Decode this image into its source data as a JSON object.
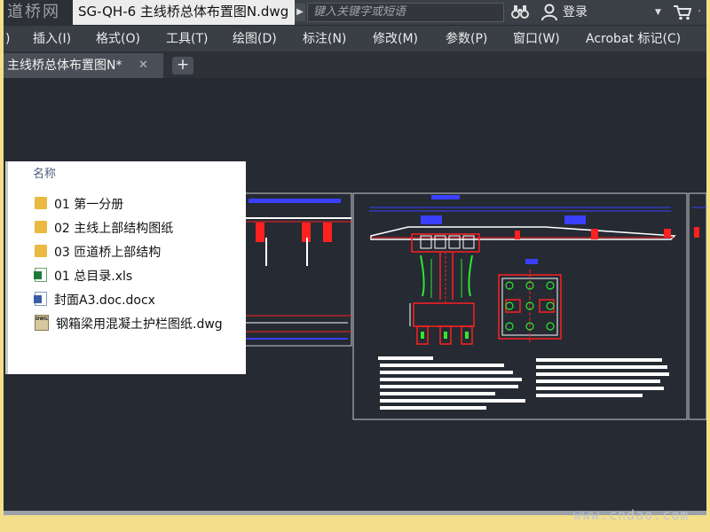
{
  "app": {
    "logo_text": "道桥网",
    "title": "SG-QH-6 主线桥总体布置图N.dwg",
    "search_placeholder": "键入关键字或短语",
    "login_label": "登录"
  },
  "menu": [
    {
      "label": ")"
    },
    {
      "label": "插入(I)"
    },
    {
      "label": "格式(O)"
    },
    {
      "label": "工具(T)"
    },
    {
      "label": "绘图(D)"
    },
    {
      "label": "标注(N)"
    },
    {
      "label": "修改(M)"
    },
    {
      "label": "参数(P)"
    },
    {
      "label": "窗口(W)"
    },
    {
      "label": "Acrobat 标记(C)"
    }
  ],
  "tabs": [
    {
      "label": "主线桥总体布置图N*"
    }
  ],
  "file_panel": {
    "column_header": "名称",
    "items": [
      {
        "name": "01 第一分册",
        "icon": "folder-icon"
      },
      {
        "name": "02 主线上部结构图纸",
        "icon": "folder-icon"
      },
      {
        "name": "03 匝道桥上部结构",
        "icon": "folder-icon"
      },
      {
        "name": "01 总目录.xls",
        "icon": "xls-icon"
      },
      {
        "name": "封面A3.doc.docx",
        "icon": "doc-icon"
      },
      {
        "name": "钢箱梁用混凝土护栏图纸.dwg",
        "icon": "dwg-icon"
      }
    ]
  },
  "watermark": "www.cndao.com",
  "colors": {
    "canvas_bg": "#252a33",
    "drawing_red": "#ff2020",
    "drawing_blue": "#3a40ff",
    "drawing_green": "#2ee82e",
    "drawing_white": "#ffffff"
  }
}
